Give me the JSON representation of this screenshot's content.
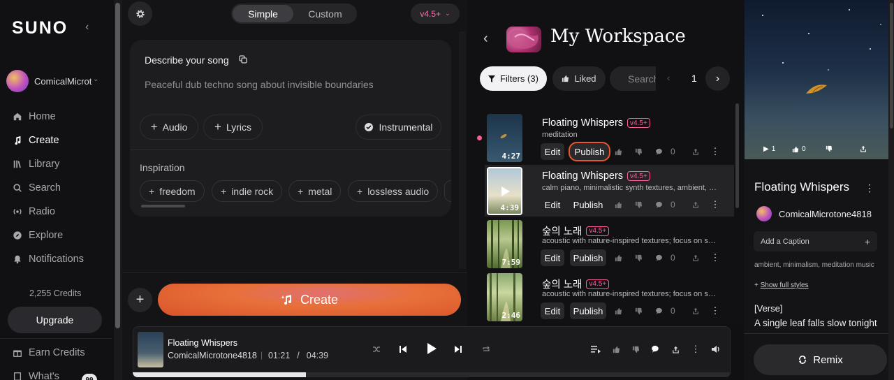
{
  "sidebar": {
    "logo": "SUNO",
    "user": "ComicalMicrot",
    "nav": [
      {
        "label": "Home",
        "icon": "home-icon"
      },
      {
        "label": "Create",
        "icon": "music-note-icon",
        "active": true
      },
      {
        "label": "Library",
        "icon": "library-icon"
      },
      {
        "label": "Search",
        "icon": "search-icon"
      },
      {
        "label": "Radio",
        "icon": "radio-icon"
      },
      {
        "label": "Explore",
        "icon": "compass-icon"
      },
      {
        "label": "Notifications",
        "icon": "bell-icon"
      }
    ],
    "credits": "2,255 Credits",
    "upgrade": "Upgrade",
    "earn": "Earn Credits",
    "whats_new": "What's",
    "whats_badge": "99"
  },
  "create": {
    "mode_simple": "Simple",
    "mode_custom": "Custom",
    "version": "v4.5+",
    "describe_label": "Describe your song",
    "describe_value": "Peaceful dub techno song about invisible boundaries",
    "audio": "Audio",
    "lyrics": "Lyrics",
    "instrumental": "Instrumental",
    "inspiration_label": "Inspiration",
    "tags": [
      "freedom",
      "indie rock",
      "metal",
      "lossless audio"
    ],
    "create_button": "Create"
  },
  "workspace": {
    "title": "My Workspace",
    "filters": "Filters (3)",
    "liked": "Liked",
    "search_placeholder": "Search",
    "page": "1",
    "songs": [
      {
        "title": "Floating Whispers",
        "version": "v4.5+",
        "subtitle": "meditation",
        "duration": "4:27",
        "edit": "Edit",
        "publish": "Publish",
        "comments": "0"
      },
      {
        "title": "Floating Whispers",
        "version": "v4.5+",
        "subtitle": "calm piano, minimalistic synth textures, ambient, meditative",
        "duration": "4:39",
        "edit": "Edit",
        "publish": "Publish",
        "comments": "0"
      },
      {
        "title": "숲의 노래",
        "version": "v4.5+",
        "subtitle": "acoustic with nature-inspired textures; focus on soft instrumentation",
        "duration": "7:59",
        "edit": "Edit",
        "publish": "Publish",
        "comments": "0"
      },
      {
        "title": "숲의 노래",
        "version": "v4.5+",
        "subtitle": "acoustic with nature-inspired textures; focus on soft instrumentation",
        "duration": "2:46",
        "edit": "Edit",
        "publish": "Publish",
        "comments": "0"
      }
    ]
  },
  "details": {
    "plays": "1",
    "likes": "0",
    "title": "Floating Whispers",
    "user": "ComicalMicrotone4818",
    "caption_placeholder": "Add a Caption",
    "styles": "ambient, minimalism, meditation music",
    "show_full": "Show full styles",
    "verse_label": "[Verse]",
    "lyric_line": "A single leaf falls slow tonight",
    "remix": "Remix"
  },
  "player": {
    "title": "Floating Whispers",
    "artist": "ComicalMicrotone4818",
    "current": "01:21",
    "total": "04:39",
    "progress": 0.29
  },
  "colors": {
    "accent": "#ff5c9c",
    "create_orange": "#e8703a",
    "publish_ring": "#e8572a"
  }
}
